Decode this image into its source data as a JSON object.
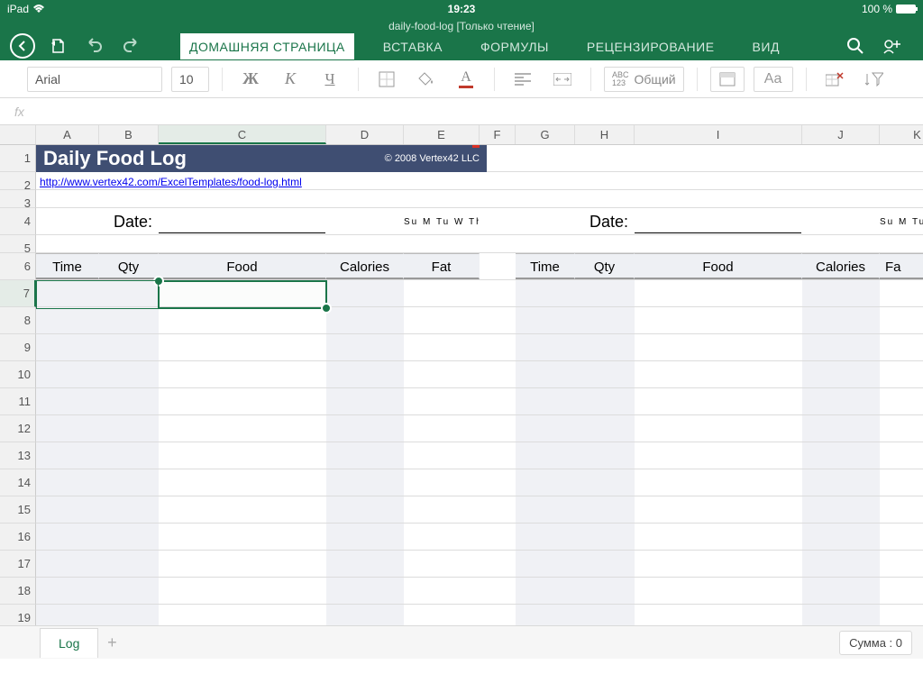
{
  "status": {
    "device": "iPad",
    "time": "19:23",
    "battery": "100 %"
  },
  "doc": {
    "title": "daily-food-log [Только чтение]"
  },
  "tabs": {
    "home": "ДОМАШНЯЯ СТРАНИЦА",
    "insert": "ВСТАВКА",
    "formulas": "ФОРМУЛЫ",
    "review": "РЕЦЕНЗИРОВАНИЕ",
    "view": "ВИД"
  },
  "fmt": {
    "font": "Arial",
    "size": "10",
    "numfmt": "Общий",
    "aa": "Aa"
  },
  "fx": "fx",
  "cols": [
    "A",
    "B",
    "C",
    "D",
    "E",
    "F",
    "G",
    "H",
    "I",
    "J",
    "K"
  ],
  "rows": [
    "1",
    "2",
    "3",
    "4",
    "5",
    "6",
    "7",
    "8",
    "9",
    "10",
    "11",
    "12",
    "13",
    "14",
    "15",
    "16",
    "17",
    "18",
    "19"
  ],
  "content": {
    "title": "Daily Food Log",
    "copyright": "© 2008 Vertex42 LLC",
    "link": "http://www.vertex42.com/ExcelTemplates/food-log.html",
    "date_label": "Date:",
    "days1": "Su  M  Tu  W  Th  F  Sa",
    "days2": "Su  M  Tu  W  Th",
    "hdr": {
      "time": "Time",
      "qty": "Qty",
      "food": "Food",
      "cal": "Calories",
      "fat": "Fat",
      "fat2": "Fa"
    }
  },
  "sheet": {
    "name": "Log",
    "summary": "Сумма : 0"
  }
}
